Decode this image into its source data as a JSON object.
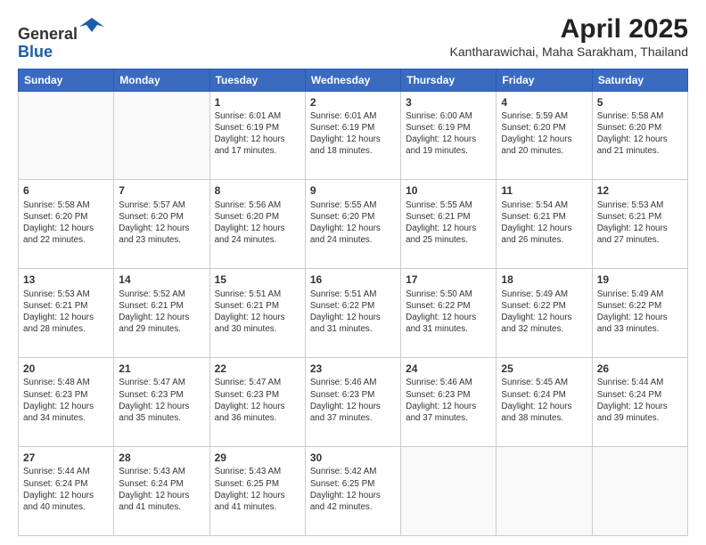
{
  "header": {
    "logo_line1": "General",
    "logo_line2": "Blue",
    "month_year": "April 2025",
    "location": "Kantharawichai, Maha Sarakham, Thailand"
  },
  "days_of_week": [
    "Sunday",
    "Monday",
    "Tuesday",
    "Wednesday",
    "Thursday",
    "Friday",
    "Saturday"
  ],
  "weeks": [
    [
      {
        "day": "",
        "info": ""
      },
      {
        "day": "",
        "info": ""
      },
      {
        "day": "1",
        "info": "Sunrise: 6:01 AM\nSunset: 6:19 PM\nDaylight: 12 hours and 17 minutes."
      },
      {
        "day": "2",
        "info": "Sunrise: 6:01 AM\nSunset: 6:19 PM\nDaylight: 12 hours and 18 minutes."
      },
      {
        "day": "3",
        "info": "Sunrise: 6:00 AM\nSunset: 6:19 PM\nDaylight: 12 hours and 19 minutes."
      },
      {
        "day": "4",
        "info": "Sunrise: 5:59 AM\nSunset: 6:20 PM\nDaylight: 12 hours and 20 minutes."
      },
      {
        "day": "5",
        "info": "Sunrise: 5:58 AM\nSunset: 6:20 PM\nDaylight: 12 hours and 21 minutes."
      }
    ],
    [
      {
        "day": "6",
        "info": "Sunrise: 5:58 AM\nSunset: 6:20 PM\nDaylight: 12 hours and 22 minutes."
      },
      {
        "day": "7",
        "info": "Sunrise: 5:57 AM\nSunset: 6:20 PM\nDaylight: 12 hours and 23 minutes."
      },
      {
        "day": "8",
        "info": "Sunrise: 5:56 AM\nSunset: 6:20 PM\nDaylight: 12 hours and 24 minutes."
      },
      {
        "day": "9",
        "info": "Sunrise: 5:55 AM\nSunset: 6:20 PM\nDaylight: 12 hours and 24 minutes."
      },
      {
        "day": "10",
        "info": "Sunrise: 5:55 AM\nSunset: 6:21 PM\nDaylight: 12 hours and 25 minutes."
      },
      {
        "day": "11",
        "info": "Sunrise: 5:54 AM\nSunset: 6:21 PM\nDaylight: 12 hours and 26 minutes."
      },
      {
        "day": "12",
        "info": "Sunrise: 5:53 AM\nSunset: 6:21 PM\nDaylight: 12 hours and 27 minutes."
      }
    ],
    [
      {
        "day": "13",
        "info": "Sunrise: 5:53 AM\nSunset: 6:21 PM\nDaylight: 12 hours and 28 minutes."
      },
      {
        "day": "14",
        "info": "Sunrise: 5:52 AM\nSunset: 6:21 PM\nDaylight: 12 hours and 29 minutes."
      },
      {
        "day": "15",
        "info": "Sunrise: 5:51 AM\nSunset: 6:21 PM\nDaylight: 12 hours and 30 minutes."
      },
      {
        "day": "16",
        "info": "Sunrise: 5:51 AM\nSunset: 6:22 PM\nDaylight: 12 hours and 31 minutes."
      },
      {
        "day": "17",
        "info": "Sunrise: 5:50 AM\nSunset: 6:22 PM\nDaylight: 12 hours and 31 minutes."
      },
      {
        "day": "18",
        "info": "Sunrise: 5:49 AM\nSunset: 6:22 PM\nDaylight: 12 hours and 32 minutes."
      },
      {
        "day": "19",
        "info": "Sunrise: 5:49 AM\nSunset: 6:22 PM\nDaylight: 12 hours and 33 minutes."
      }
    ],
    [
      {
        "day": "20",
        "info": "Sunrise: 5:48 AM\nSunset: 6:23 PM\nDaylight: 12 hours and 34 minutes."
      },
      {
        "day": "21",
        "info": "Sunrise: 5:47 AM\nSunset: 6:23 PM\nDaylight: 12 hours and 35 minutes."
      },
      {
        "day": "22",
        "info": "Sunrise: 5:47 AM\nSunset: 6:23 PM\nDaylight: 12 hours and 36 minutes."
      },
      {
        "day": "23",
        "info": "Sunrise: 5:46 AM\nSunset: 6:23 PM\nDaylight: 12 hours and 37 minutes."
      },
      {
        "day": "24",
        "info": "Sunrise: 5:46 AM\nSunset: 6:23 PM\nDaylight: 12 hours and 37 minutes."
      },
      {
        "day": "25",
        "info": "Sunrise: 5:45 AM\nSunset: 6:24 PM\nDaylight: 12 hours and 38 minutes."
      },
      {
        "day": "26",
        "info": "Sunrise: 5:44 AM\nSunset: 6:24 PM\nDaylight: 12 hours and 39 minutes."
      }
    ],
    [
      {
        "day": "27",
        "info": "Sunrise: 5:44 AM\nSunset: 6:24 PM\nDaylight: 12 hours and 40 minutes."
      },
      {
        "day": "28",
        "info": "Sunrise: 5:43 AM\nSunset: 6:24 PM\nDaylight: 12 hours and 41 minutes."
      },
      {
        "day": "29",
        "info": "Sunrise: 5:43 AM\nSunset: 6:25 PM\nDaylight: 12 hours and 41 minutes."
      },
      {
        "day": "30",
        "info": "Sunrise: 5:42 AM\nSunset: 6:25 PM\nDaylight: 12 hours and 42 minutes."
      },
      {
        "day": "",
        "info": ""
      },
      {
        "day": "",
        "info": ""
      },
      {
        "day": "",
        "info": ""
      }
    ]
  ]
}
